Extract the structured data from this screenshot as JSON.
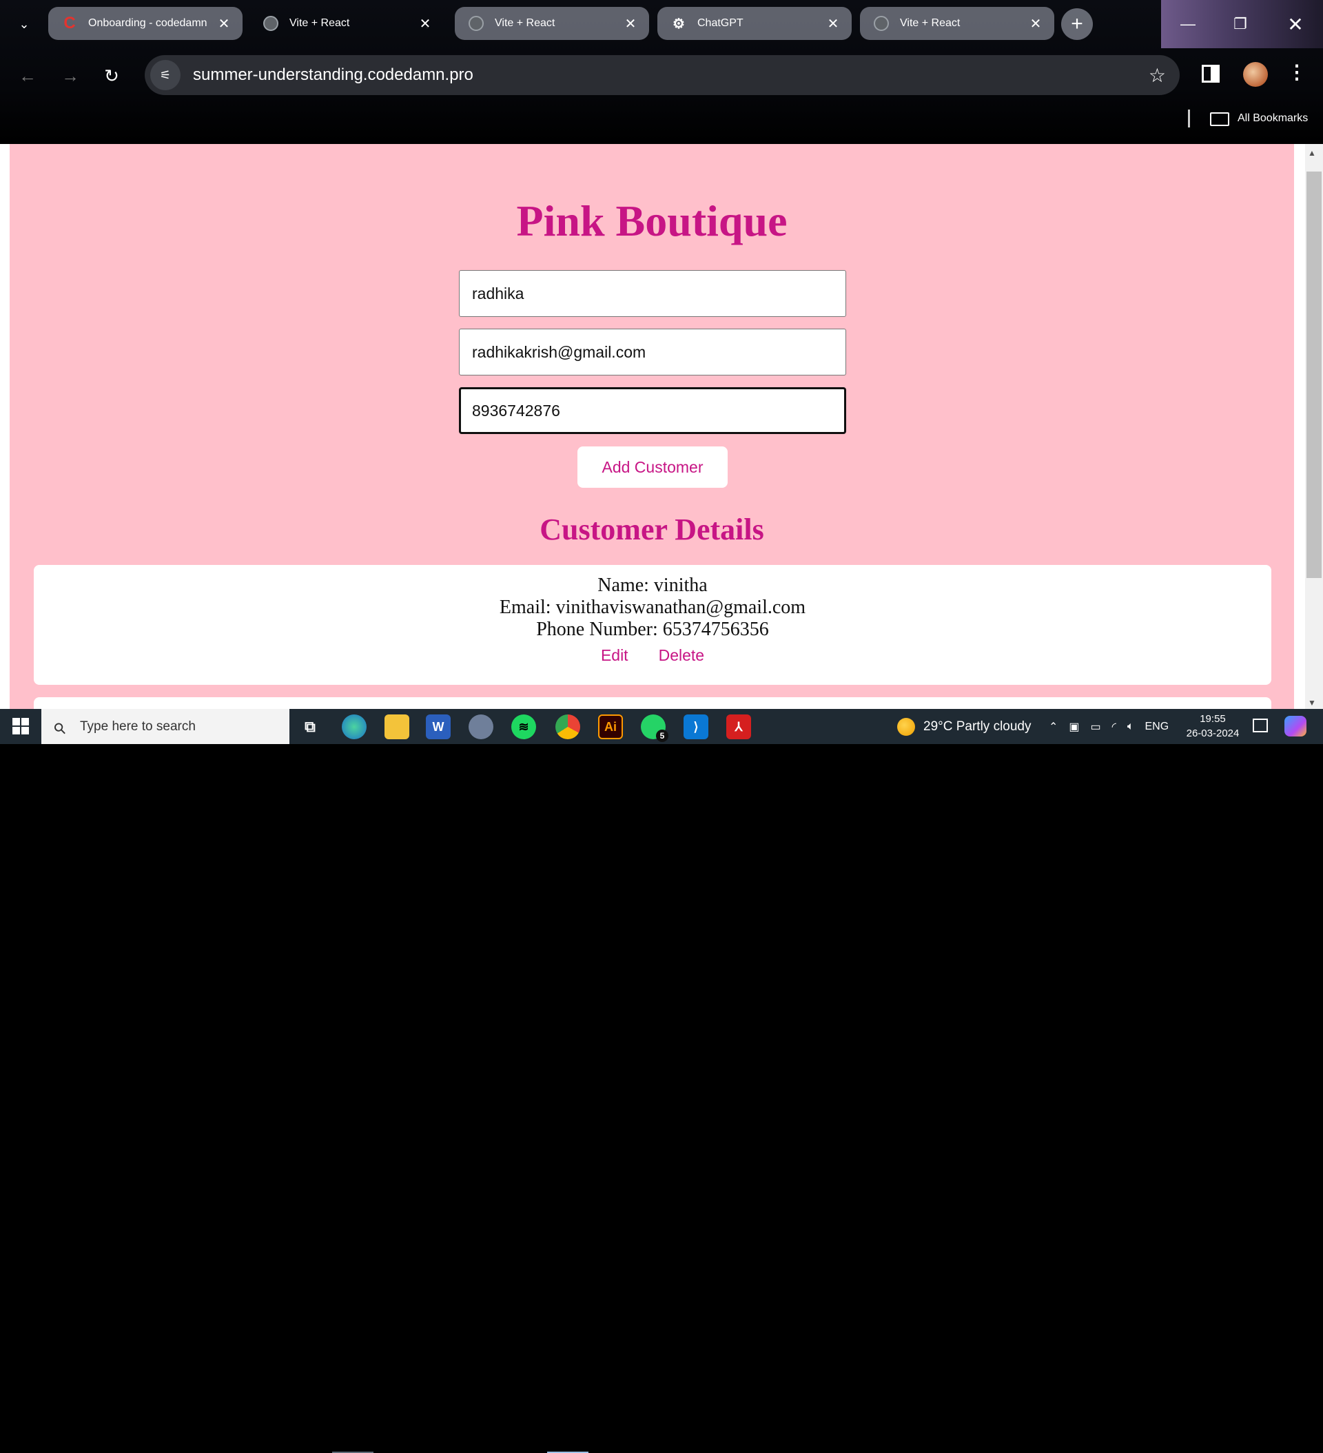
{
  "browser": {
    "tabs": [
      {
        "title": "Onboarding - codedamn",
        "favicon": "codedamn-icon",
        "active": false
      },
      {
        "title": "Vite + React",
        "favicon": "globe-icon",
        "active": true
      },
      {
        "title": "Vite + React",
        "favicon": "globe-icon",
        "active": false
      },
      {
        "title": "ChatGPT",
        "favicon": "chatgpt-icon",
        "active": false
      },
      {
        "title": "Vite + React",
        "favicon": "globe-icon",
        "active": false
      }
    ],
    "url": "summer-understanding.codedamn.pro",
    "bookmarks_label": "All Bookmarks"
  },
  "page": {
    "title": "Pink Boutique",
    "form": {
      "name_value": "radhika",
      "email_value": "radhikakrish@gmail.com",
      "phone_value": "8936742876",
      "add_button": "Add Customer"
    },
    "section_title": "Customer Details",
    "customers": [
      {
        "name": "Name: vinitha",
        "email": "Email: vinithaviswanathan@gmail.com",
        "phone": "Phone Number: 65374756356",
        "edit": "Edit",
        "delete": "Delete"
      }
    ],
    "colors": {
      "background": "#ffc0cb",
      "accent": "#c71585"
    }
  },
  "taskbar": {
    "search_placeholder": "Type here to search",
    "weather": "29°C  Partly cloudy",
    "language": "ENG",
    "time": "19:55",
    "date": "26-03-2024",
    "whatsapp_badge": "5"
  }
}
